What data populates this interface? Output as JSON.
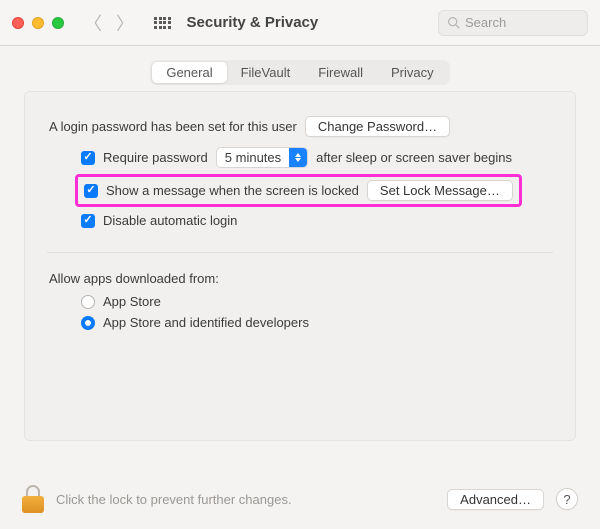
{
  "window": {
    "title": "Security & Privacy"
  },
  "search": {
    "placeholder": "Search"
  },
  "tabs": {
    "general": "General",
    "filevault": "FileVault",
    "firewall": "Firewall",
    "privacy": "Privacy"
  },
  "general": {
    "password_set_text": "A login password has been set for this user",
    "change_password_btn": "Change Password…",
    "require_password_label": "Require password",
    "delay_value": "5 minutes",
    "after_sleep_text": "after sleep or screen saver begins",
    "show_message_label": "Show a message when the screen is locked",
    "set_lock_message_btn": "Set Lock Message…",
    "disable_auto_login_label": "Disable automatic login",
    "allow_apps_label": "Allow apps downloaded from:",
    "opt_appstore": "App Store",
    "opt_appstore_dev": "App Store and identified developers"
  },
  "footer": {
    "lock_text": "Click the lock to prevent further changes.",
    "advanced_btn": "Advanced…",
    "help": "?"
  }
}
